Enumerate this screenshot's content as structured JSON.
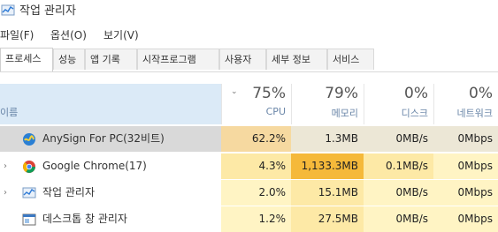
{
  "window": {
    "title": "작업 관리자"
  },
  "menu": [
    "파일(F)",
    "옵션(O)",
    "보기(V)"
  ],
  "tabs": [
    "프로세스",
    "성능",
    "앱 기록",
    "시작프로그램",
    "사용자",
    "세부 정보",
    "서비스"
  ],
  "columns": {
    "name": "이름",
    "cpu": {
      "pct": "75%",
      "label": "CPU"
    },
    "memory": {
      "pct": "79%",
      "label": "메모리"
    },
    "disk": {
      "pct": "0%",
      "label": "디스크"
    },
    "network": {
      "pct": "0%",
      "label": "네트워크"
    }
  },
  "processes": [
    {
      "name": "AnySign For PC(32비트)",
      "cpu": "62.2%",
      "memory": "1.3MB",
      "disk": "0MB/s",
      "network": "0Mbps",
      "icon": "anysign-icon"
    },
    {
      "name": "Google Chrome(17)",
      "cpu": "4.3%",
      "memory": "1,133.3MB",
      "disk": "0.1MB/s",
      "network": "0Mbps",
      "icon": "chrome-icon"
    },
    {
      "name": "작업 관리자",
      "cpu": "2.0%",
      "memory": "15.1MB",
      "disk": "0MB/s",
      "network": "0Mbps",
      "icon": "task-manager-icon"
    },
    {
      "name": "데스크톱 창 관리자",
      "cpu": "1.2%",
      "memory": "27.5MB",
      "disk": "0MB/s",
      "network": "0Mbps",
      "icon": "desktop-window-manager-icon"
    }
  ],
  "colors": {
    "selected_row": "#d9d9d9",
    "header_highlight": "#dbeaf7",
    "heat_light": "#fff4c4",
    "heat_mid": "#fde9a6",
    "heat_strong": "#f9c95e",
    "heat_hot": "#f5b93a"
  }
}
